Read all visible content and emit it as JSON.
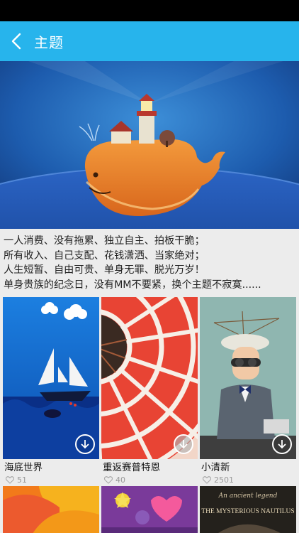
{
  "app_bar": {
    "title": "主题"
  },
  "description": {
    "lines": [
      "一人消费、没有拖累、独立自主、拍板干脆；",
      "所有收入、自己支配、花钱潇洒、当家绝对；",
      "人生短暂、自由可贵、单身无罪、脱光万岁！",
      "单身贵族的纪念日，没有MM不要紧，换个主题不寂寞......"
    ]
  },
  "themes": [
    {
      "title": "海底世界",
      "likes": "51"
    },
    {
      "title": "重返赛普特恩",
      "likes": "40"
    },
    {
      "title": "小清新",
      "likes": "2501"
    }
  ],
  "bottom_row": {
    "nautilus_line1": "An ancient legend",
    "nautilus_line2": "THE MYSTERIOUS NAUTILUS"
  },
  "icons": [
    "back-arrow-icon",
    "download-icon",
    "heart-icon"
  ],
  "colors": {
    "app_bar": "#27b4ec",
    "status_bar": "#000000",
    "background": "#ececec"
  }
}
